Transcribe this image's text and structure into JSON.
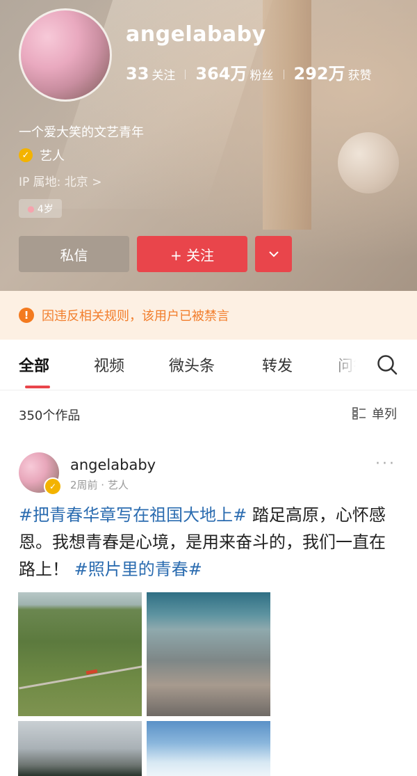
{
  "profile": {
    "username": "angelababy",
    "stats": [
      {
        "num": "33",
        "label": "关注"
      },
      {
        "num": "364万",
        "label": "粉丝"
      },
      {
        "num": "292万",
        "label": "获赞"
      }
    ],
    "bio": "一个爱大笑的文艺青年",
    "verify_label": "艺人",
    "ip_location": "IP 属地: 北京 >",
    "age_badge": "4岁"
  },
  "actions": {
    "message_label": "私信",
    "follow_label": "+ 关注",
    "more_icon": "chevron-down"
  },
  "notice": {
    "text": "因违反相关规则，该用户已被禁言",
    "color": "#f27d2b"
  },
  "tabs": [
    {
      "label": "全部",
      "active": true
    },
    {
      "label": "视频"
    },
    {
      "label": "微头条"
    },
    {
      "label": "转发"
    },
    {
      "label": "问答"
    }
  ],
  "list_header": {
    "count": "350个作品",
    "view_mode": "单列"
  },
  "post": {
    "author": "angelababy",
    "meta": "2周前 · 艺人",
    "text_parts": [
      {
        "text": "#把青春华章写在祖国大地上#",
        "hashtag": true
      },
      {
        "text": " 踏足高原，心怀感恩。我想青春是心境，是用来奋斗的，我们一直在路上！ ",
        "hashtag": false
      },
      {
        "text": "#照片里的青春#",
        "hashtag": true
      }
    ]
  },
  "colors": {
    "accent": "#e9454b",
    "hashtag": "#2b6cb0",
    "verify": "#f3b300"
  }
}
